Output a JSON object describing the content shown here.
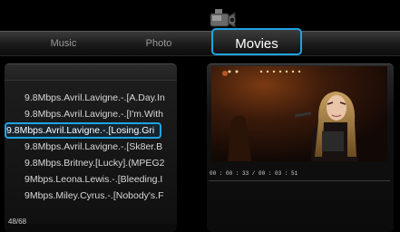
{
  "tabs": [
    {
      "label": "Music"
    },
    {
      "label": "Photo"
    },
    {
      "label": "Movies",
      "active": true
    }
  ],
  "files": [
    "9.8Mbps.Avril.Lavigne.-.[A.Day.In",
    "9.8Mbps.Avril.Lavigne.-.[I'm.With",
    "9.8Mbps.Avril.Lavigne.-.[Losing.Gri",
    "9.8Mbps.Avril.Lavigne.-.[Sk8er.B",
    "9.8Mbps.Britney.[Lucky].(MPEG2",
    "9Mbps.Leona.Lewis.-.[Bleeding.I",
    "9Mbps.Miley.Cyrus.-.[Nobody's.F"
  ],
  "selected_index": 2,
  "counter": "48/68",
  "preview": {
    "timecode": "00 : 00 : 33 / 00 : 03 : 51"
  },
  "colors": {
    "accent": "#1fa3e4",
    "background": "#000000"
  },
  "icons": {
    "category": "video-camera-icon"
  }
}
